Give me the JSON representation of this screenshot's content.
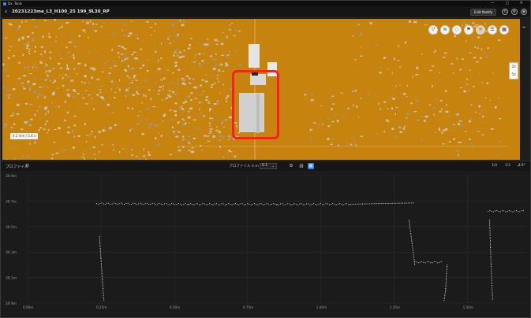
{
  "os": {
    "app_name": "Dx. Tools",
    "controls": "— ▢ ✕"
  },
  "header": {
    "file_name": "20231223me_L3_H100_25 199_SL30_RP",
    "edit_label": "Edit Notify",
    "icons": [
      "share-icon",
      "settings-icon",
      "user-icon"
    ]
  },
  "viewport": {
    "toolbar_icons": [
      "filter-icon",
      "layers-icon",
      "light-icon",
      "flag-icon",
      "sun-icon",
      "list-icon",
      "grid-icon"
    ],
    "zoom": {
      "top": "20",
      "bottom": "50"
    },
    "label_tag": "4.2 mm / 5.8 s",
    "highlight_color": "#ff1d1d",
    "background_color": "#c6840f"
  },
  "panel": {
    "title": "プロファイル",
    "range_label": "プロファイル 4 m",
    "range_value": "0.1",
    "rates": [
      "1/4",
      "1/2",
      "1/1"
    ]
  },
  "chart_data": {
    "type": "scatter",
    "title": "",
    "xlabel": "",
    "ylabel": "",
    "y_ticks": [
      "30.9m",
      "30.7m",
      "30.5m",
      "30.3m",
      "30.1m",
      "29.9m"
    ],
    "x_ticks": [
      "0.00m",
      "0.25m",
      "0.50m",
      "0.75m",
      "1.00m",
      "1.25m",
      "1.50m"
    ],
    "ylim": [
      29.9,
      30.9
    ],
    "xlim": [
      0,
      1.7
    ],
    "grid": true,
    "series": [
      {
        "color": "#e8e8e8",
        "segments": [
          [
            [
              0.235,
              30.68
            ],
            [
              0.55,
              30.675
            ],
            [
              0.85,
              30.675
            ],
            [
              1.1,
              30.675
            ],
            [
              1.315,
              30.685
            ]
          ],
          [
            [
              0.245,
              30.42
            ],
            [
              0.25,
              30.25
            ],
            [
              0.255,
              30.08
            ],
            [
              0.26,
              29.92
            ]
          ],
          [
            [
              1.3,
              30.55
            ],
            [
              1.31,
              30.38
            ],
            [
              1.32,
              30.2
            ]
          ],
          [
            [
              1.32,
              30.22
            ],
            [
              1.41,
              30.22
            ]
          ],
          [
            [
              1.43,
              30.2
            ],
            [
              1.425,
              30.0
            ],
            [
              1.42,
              29.92
            ]
          ],
          [
            [
              1.57,
              30.62
            ],
            [
              1.69,
              30.62
            ]
          ],
          [
            [
              1.575,
              30.55
            ],
            [
              1.58,
              30.2
            ],
            [
              1.585,
              29.93
            ]
          ]
        ]
      }
    ]
  }
}
